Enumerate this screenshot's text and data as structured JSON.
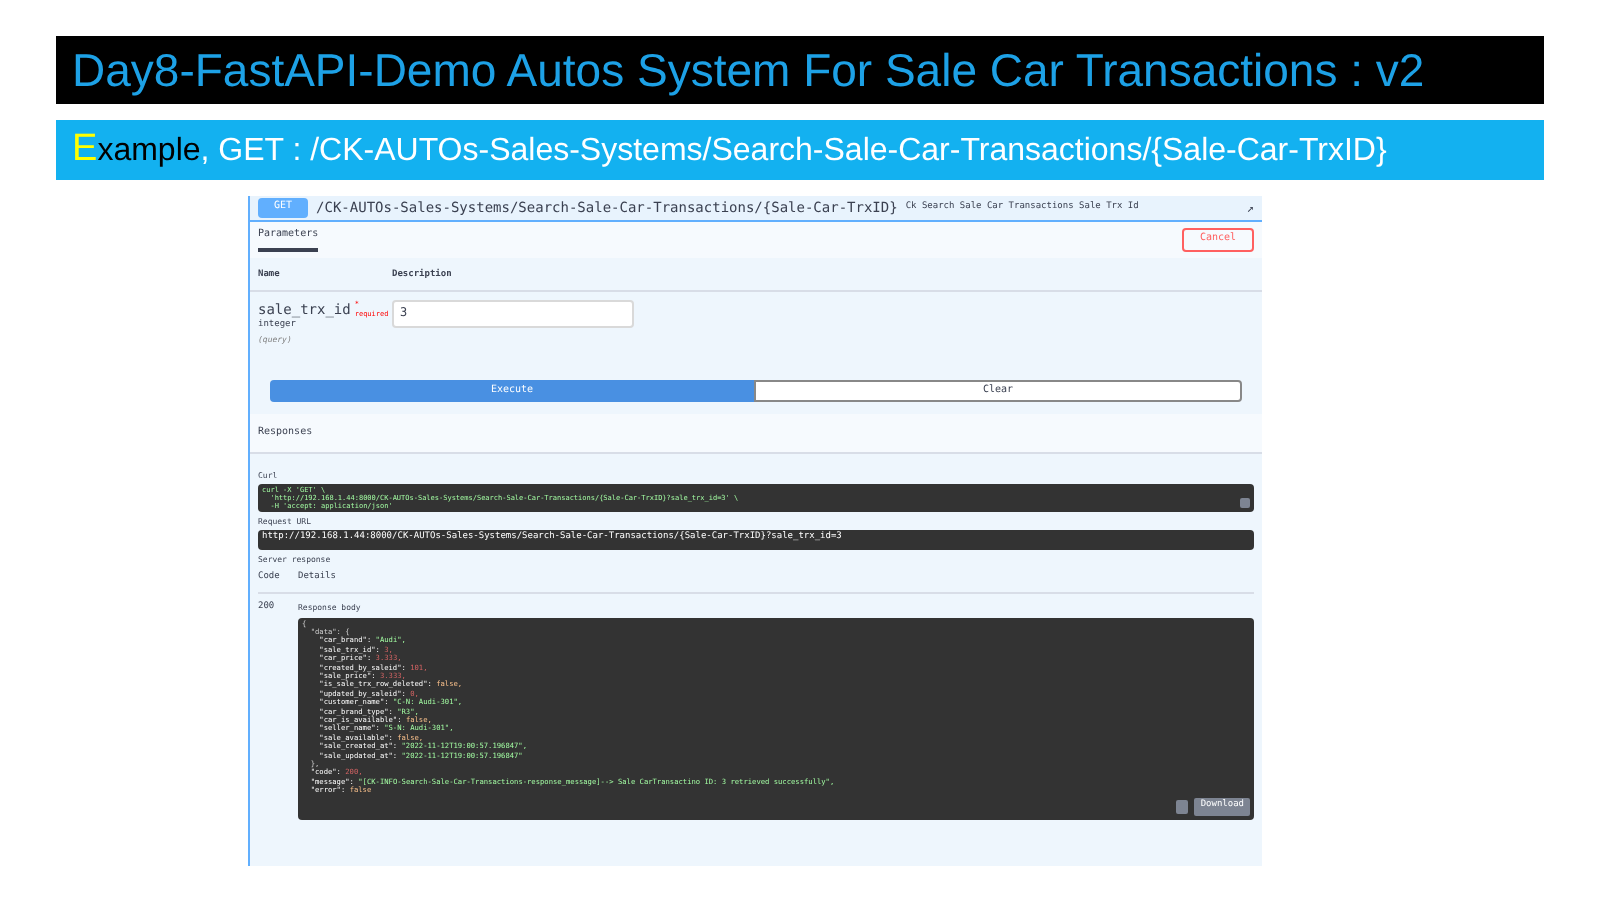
{
  "slide_title": "Day8-FastAPI-Demo Autos System For Sale Car Transactions : v2",
  "subtitle": {
    "first_letter": "E",
    "word": "xample",
    "rest": ", GET : /CK-AUTOs-Sales-Systems/Search-Sale-Car-Transactions/{Sale-Car-TrxID}"
  },
  "operation": {
    "method": "GET",
    "path": "/CK-AUTOs-Sales-Systems/Search-Sale-Car-Transactions/{Sale-Car-TrxID}",
    "summary": "Ck Search Sale Car Transactions Sale Trx Id",
    "collapse_icon": "↗"
  },
  "parameters": {
    "tab": "Parameters",
    "cancel": "Cancel",
    "col_name": "Name",
    "col_description": "Description",
    "param": {
      "name": "sale_trx_id",
      "required_mark": "* required",
      "type": "integer",
      "location": "(query)",
      "value": "3"
    }
  },
  "execute": "Execute",
  "clear": "Clear",
  "responses_title": "Responses",
  "curl": {
    "label": "Curl",
    "lines": [
      "curl -X 'GET' \\",
      "  'http://192.168.1.44:8000/CK-AUTOs-Sales-Systems/Search-Sale-Car-Transactions/{Sale-Car-TrxID}?sale_trx_id=3' \\",
      "  -H 'accept: application/json'"
    ]
  },
  "request_url": {
    "label": "Request URL",
    "value": "http://192.168.1.44:8000/CK-AUTOs-Sales-Systems/Search-Sale-Car-Transactions/{Sale-Car-TrxID}?sale_trx_id=3"
  },
  "server_response": {
    "label": "Server response",
    "col_code": "Code",
    "col_details": "Details",
    "code": "200",
    "body_label": "Response body",
    "download": "Download",
    "body_lines": [
      {
        "key": "{",
        "kind": "plain"
      },
      {
        "key": "  \"data\": {",
        "kind": "plain"
      },
      {
        "key": "    \"car_brand\": ",
        "value": "\"Audi\",",
        "kind": "string"
      },
      {
        "key": "    \"sale_trx_id\": ",
        "value": "3,",
        "kind": "number"
      },
      {
        "key": "    \"car_price\": ",
        "value": "3.333,",
        "kind": "number"
      },
      {
        "key": "    \"created_by_saleid\": ",
        "value": "101,",
        "kind": "number"
      },
      {
        "key": "    \"sale_price\": ",
        "value": "3.333,",
        "kind": "number"
      },
      {
        "key": "    \"is_sale_trx_row_deleted\": ",
        "value": "false,",
        "kind": "literal"
      },
      {
        "key": "    \"updated_by_saleid\": ",
        "value": "0,",
        "kind": "number"
      },
      {
        "key": "    \"customer_name\": ",
        "value": "\"C-N: Audi-301\",",
        "kind": "string"
      },
      {
        "key": "    \"car_brand_type\": ",
        "value": "\"R3\",",
        "kind": "string"
      },
      {
        "key": "    \"car_is_available\": ",
        "value": "false,",
        "kind": "literal"
      },
      {
        "key": "    \"seller_name\": ",
        "value": "\"S-N: Audi-301\",",
        "kind": "string"
      },
      {
        "key": "    \"sale_available\": ",
        "value": "false,",
        "kind": "literal"
      },
      {
        "key": "    \"sale_created_at\": ",
        "value": "\"2022-11-12T19:00:57.196847\",",
        "kind": "string"
      },
      {
        "key": "    \"sale_updated_at\": ",
        "value": "\"2022-11-12T19:00:57.196847\"",
        "kind": "string"
      },
      {
        "key": "  },",
        "kind": "plain"
      },
      {
        "key": "  \"code\": ",
        "value": "200,",
        "kind": "number"
      },
      {
        "key": "  \"message\": ",
        "value": "\"[CK-INFO-Search-Sale-Car-Transactions-response_message]--> Sale CarTransactino ID: 3 retrieved successfully\",",
        "kind": "string"
      },
      {
        "key": "  \"error\": ",
        "value": "false",
        "kind": "literal"
      }
    ]
  }
}
